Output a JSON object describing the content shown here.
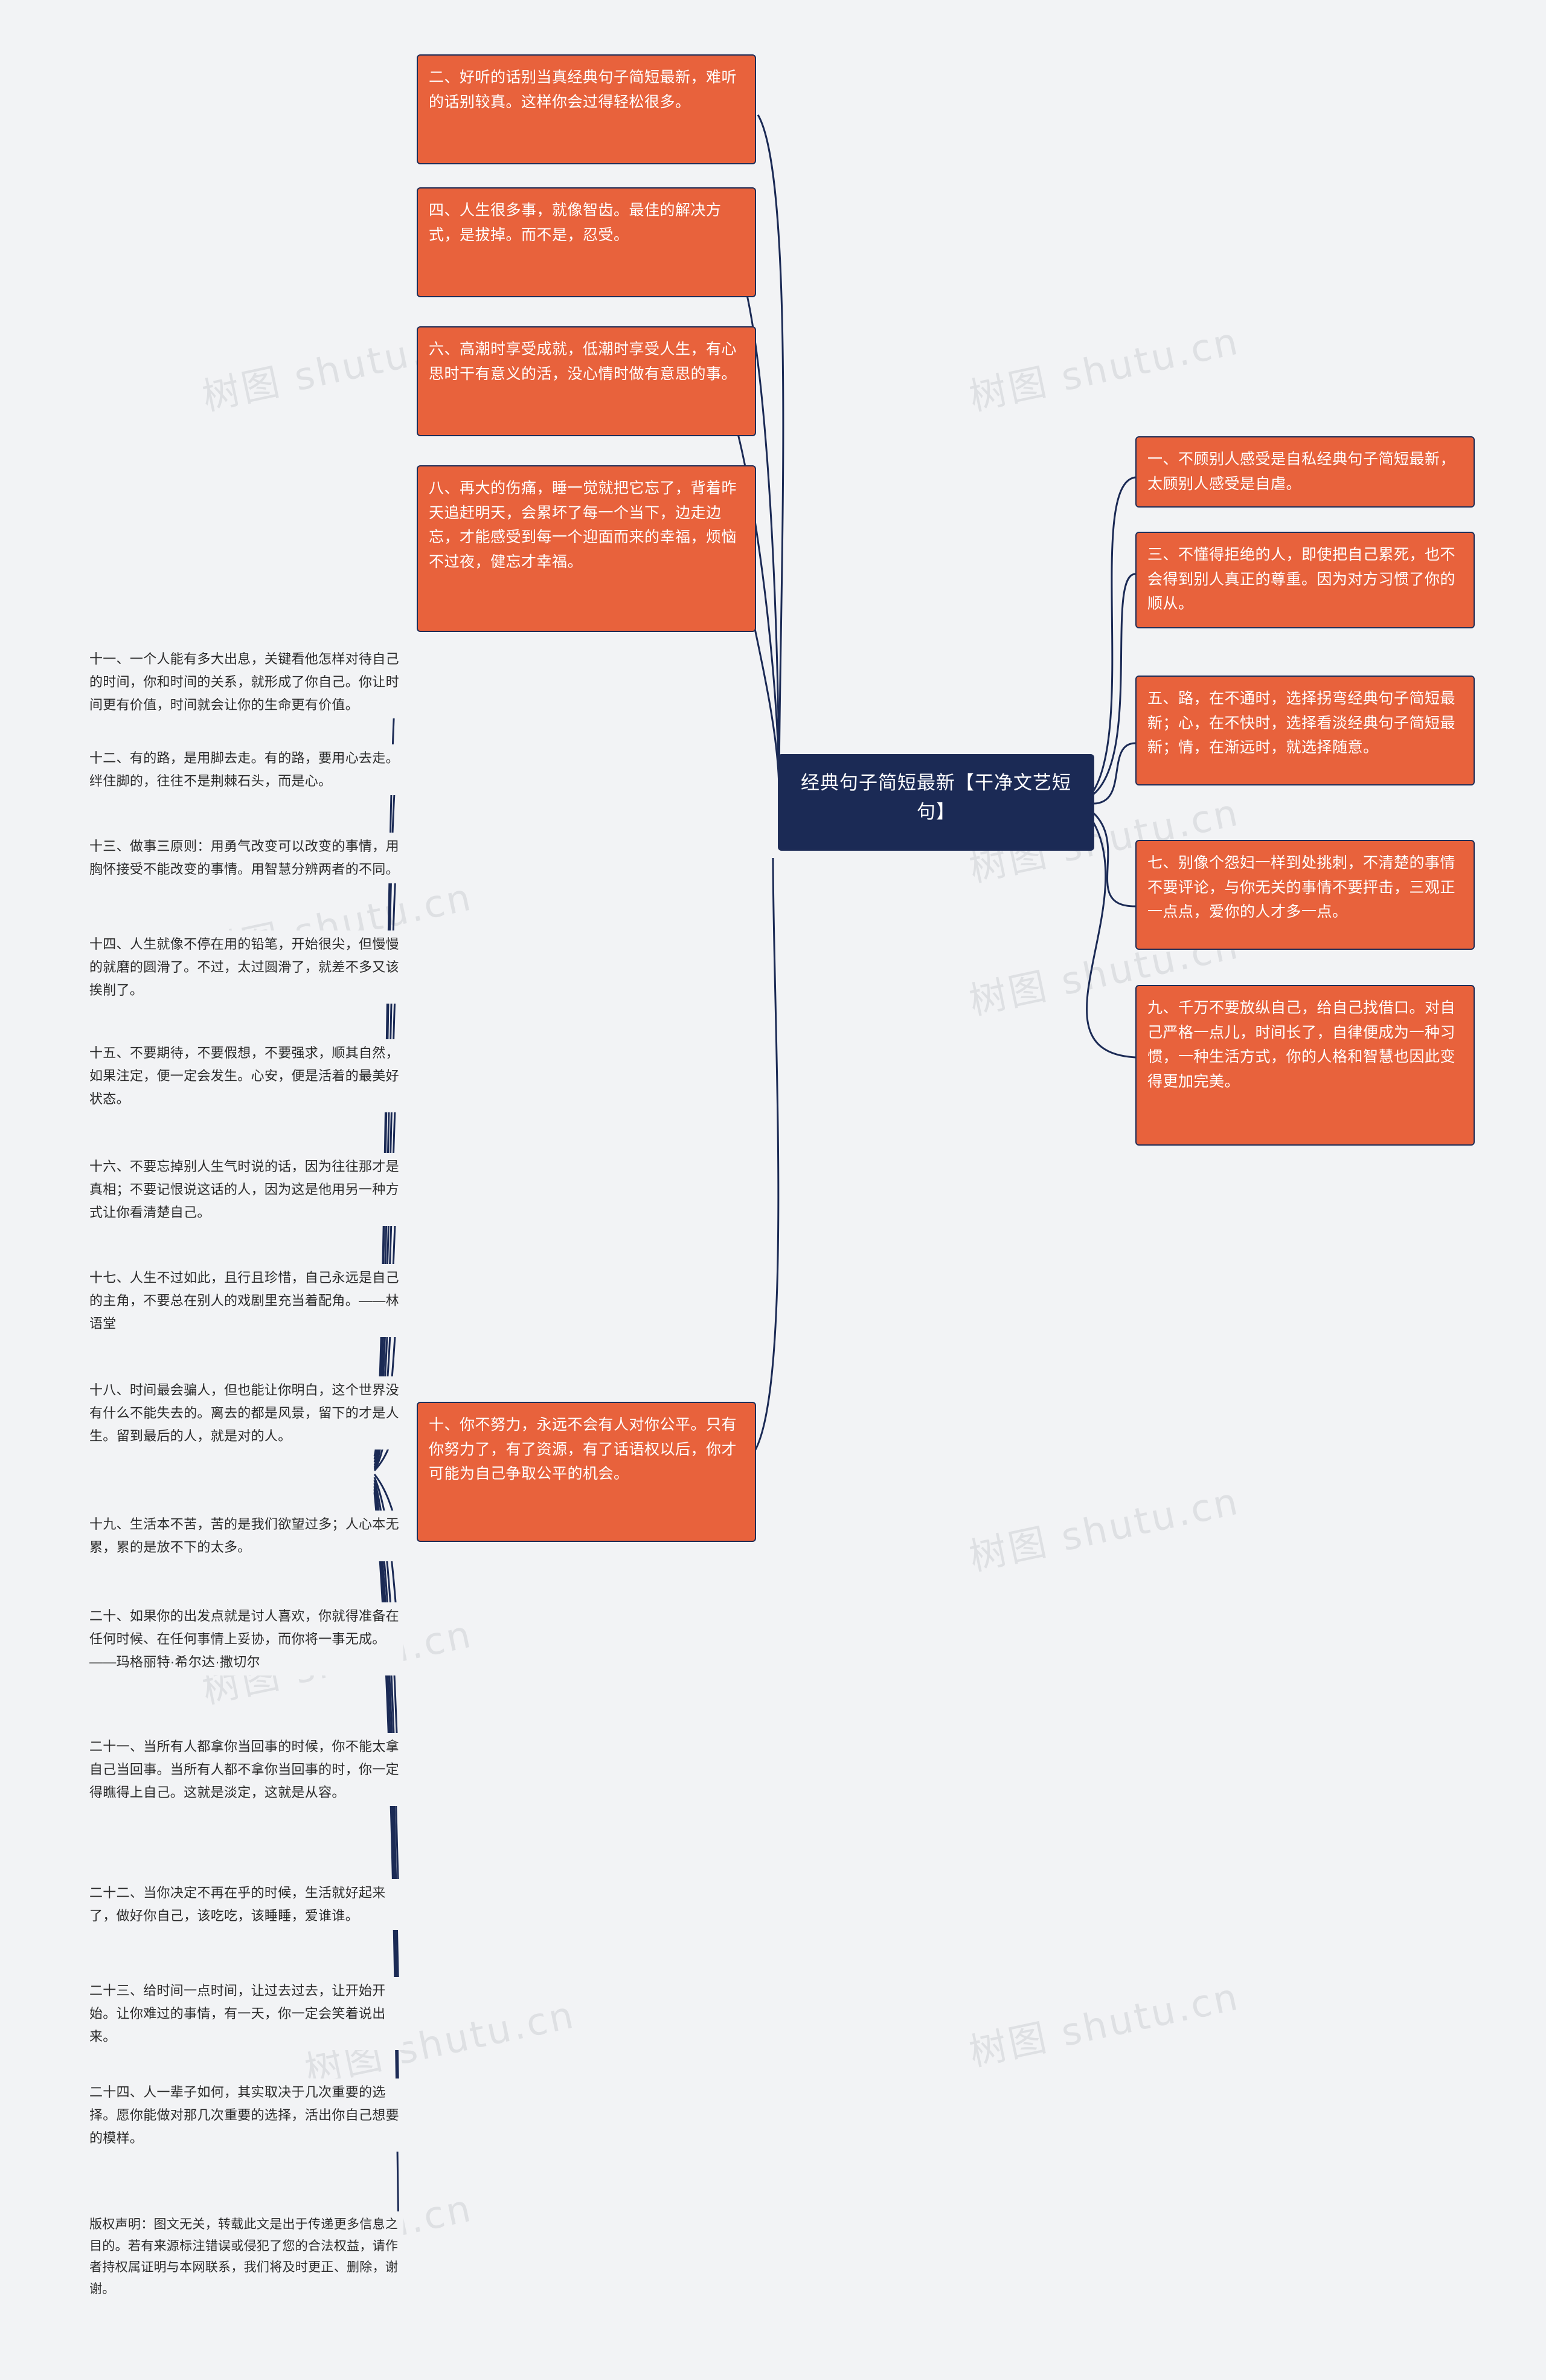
{
  "center": {
    "title": "经典句子简短最新【干净文艺短句】"
  },
  "watermarks": [
    "树图 shutu.cn",
    "树图 shutu.cn",
    "树图 shutu.cn",
    "树图 shutu.cn",
    "树图 shutu.cn",
    "树图 shutu.cn",
    "树图 shutu.cn",
    "树图 shutu.cn",
    "树图 shutu.cn",
    "树图 shutu.cn"
  ],
  "left_top_nodes": [
    {
      "text": "二、好听的话别当真经典句子简短最新，难听的话别较真。这样你会过得轻松很多。"
    },
    {
      "text": "四、人生很多事，就像智齿。最佳的解决方式，是拔掉。而不是，忍受。"
    },
    {
      "text": "六、高潮时享受成就，低潮时享受人生，有心思时干有意义的活，没心情时做有意思的事。"
    },
    {
      "text": "八、再大的伤痛，睡一觉就把它忘了，背着昨天追赶明天，会累坏了每一个当下，边走边忘，才能感受到每一个迎面而来的幸福，烦恼不过夜，健忘才幸福。"
    }
  ],
  "left_bottom_node": {
    "text": "十、你不努力，永远不会有人对你公平。只有你努力了，有了资源，有了话语权以后，你才可能为自己争取公平的机会。"
  },
  "right_nodes": [
    {
      "text": "一、不顾别人感受是自私经典句子简短最新，太顾别人感受是自虐。"
    },
    {
      "text": "三、不懂得拒绝的人，即使把自己累死，也不会得到别人真正的尊重。因为对方习惯了你的顺从。"
    },
    {
      "text": "五、路，在不通时，选择拐弯经典句子简短最新；心，在不快时，选择看淡经典句子简短最新；情，在渐远时，就选择随意。"
    },
    {
      "text": "七、别像个怨妇一样到处挑刺，不清楚的事情不要评论，与你无关的事情不要抨击，三观正一点点，爱你的人才多一点。"
    },
    {
      "text": "九、千万不要放纵自己，给自己找借口。对自己严格一点儿，时间长了，自律便成为一种习惯，一种生活方式，你的人格和智慧也因此变得更加完美。"
    }
  ],
  "list_items": [
    {
      "text": "十一、一个人能有多大出息，关键看他怎样对待自己的时间，你和时间的关系，就形成了你自己。你让时间更有价值，时间就会让你的生命更有价值。"
    },
    {
      "text": "十二、有的路，是用脚去走。有的路，要用心去走。绊住脚的，往往不是荆棘石头，而是心。"
    },
    {
      "text": "十三、做事三原则：用勇气改变可以改变的事情，用胸怀接受不能改变的事情。用智慧分辨两者的不同。"
    },
    {
      "text": "十四、人生就像不停在用的铅笔，开始很尖，但慢慢的就磨的圆滑了。不过，太过圆滑了，就差不多又该挨削了。"
    },
    {
      "text": "十五、不要期待，不要假想，不要强求，顺其自然，如果注定，便一定会发生。心安，便是活着的最美好状态。"
    },
    {
      "text": "十六、不要忘掉别人生气时说的话，因为往往那才是真相；不要记恨说这话的人，因为这是他用另一种方式让你看清楚自己。"
    },
    {
      "text": "十七、人生不过如此，且行且珍惜，自己永远是自己的主角，不要总在别人的戏剧里充当着配角。——林语堂"
    },
    {
      "text": "十八、时间最会骗人，但也能让你明白，这个世界没有什么不能失去的。离去的都是风景，留下的才是人生。留到最后的人，就是对的人。"
    },
    {
      "text": "十九、生活本不苦，苦的是我们欲望过多；人心本无累，累的是放不下的太多。"
    },
    {
      "text": "二十、如果你的出发点就是讨人喜欢，你就得准备在任何时候、在任何事情上妥协，而你将一事无成。——玛格丽特·希尔达·撒切尔"
    },
    {
      "text": "二十一、当所有人都拿你当回事的时候，你不能太拿自己当回事。当所有人都不拿你当回事的时，你一定得瞧得上自己。这就是淡定，这就是从容。"
    },
    {
      "text": "二十二、当你决定不再在乎的时候，生活就好起来了，做好你自己，该吃吃，该睡睡，爱谁谁。"
    },
    {
      "text": "二十三、给时间一点时间，让过去过去，让开始开始。让你难过的事情，有一天，你一定会笑着说出来。"
    },
    {
      "text": "二十四、人一辈子如何，其实取决于几次重要的选择。愿你能做对那几次重要的选择，活出你自己想要的模样。"
    }
  ],
  "copyright": {
    "text": "版权声明：图文无关，转载此文是出于传递更多信息之目的。若有来源标注错误或侵犯了您的合法权益，请作者持权属证明与本网联系，我们将及时更正、删除，谢谢。"
  },
  "colors": {
    "node_fill": "#e8623c",
    "node_border": "#1f2d57",
    "center_fill": "#1b2a55",
    "edge": "#1b2a55",
    "background": "#f2f3f5"
  }
}
